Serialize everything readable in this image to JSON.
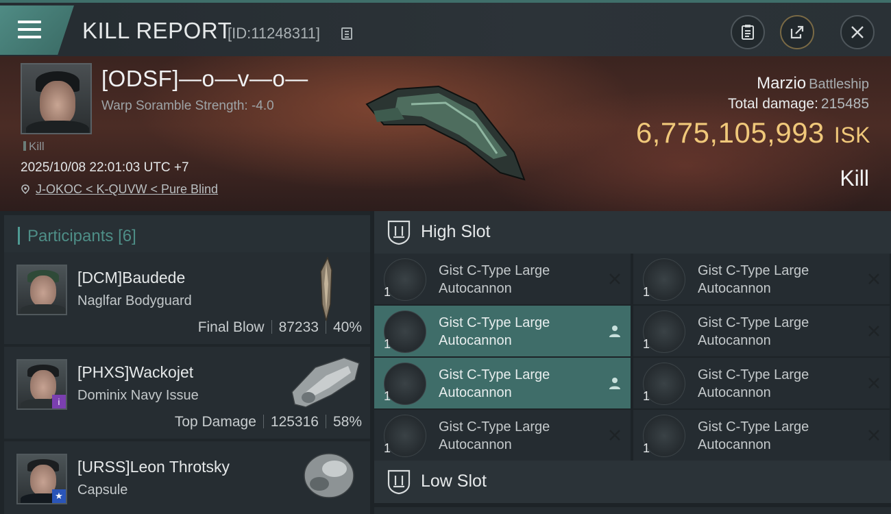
{
  "header": {
    "title": "KILL REPORT",
    "report_id": "[ID:11248311]"
  },
  "victim": {
    "name": "[ODSF]—o—v—o—",
    "subtitle": "Warp Soramble Strength: -4.0",
    "tag": "Kill",
    "timestamp": "2025/10/08 22:01:03 UTC +7",
    "location": "J-OKOC < K-QUVW < Pure Blind",
    "ship_name": "Marzio",
    "ship_class": "Battleship",
    "total_damage_label": "Total damage:",
    "total_damage": "215485",
    "isk_value": "6,775,105,993",
    "isk_unit": "ISK",
    "result": "Kill"
  },
  "participants": {
    "label": "Participants",
    "count": "[6]",
    "items": [
      {
        "name": "[DCM]Baudede",
        "ship": "Naglfar Bodyguard",
        "role": "Final Blow",
        "damage": "87233",
        "percent": "40%"
      },
      {
        "name": "[PHXS]Wackojet",
        "ship": "Dominix Navy Issue",
        "role": "Top Damage",
        "damage": "125316",
        "percent": "58%"
      },
      {
        "name": "[URSS]Leon Throtsky",
        "ship": "Capsule"
      }
    ]
  },
  "slots": {
    "high_label": "High Slot",
    "low_label": "Low Slot",
    "modules": [
      {
        "qty": "1",
        "name_line1": "Gist C-Type Large",
        "name_line2": "Autocannon",
        "status": "destroyed"
      },
      {
        "qty": "1",
        "name_line1": "Gist C-Type Large",
        "name_line2": "Autocannon",
        "status": "destroyed"
      },
      {
        "qty": "1",
        "name_line1": "Gist C-Type Large",
        "name_line2": "Autocannon",
        "status": "dropped"
      },
      {
        "qty": "1",
        "name_line1": "Gist C-Type Large",
        "name_line2": "Autocannon",
        "status": "destroyed"
      },
      {
        "qty": "1",
        "name_line1": "Gist C-Type Large",
        "name_line2": "Autocannon",
        "status": "dropped"
      },
      {
        "qty": "1",
        "name_line1": "Gist C-Type Large",
        "name_line2": "Autocannon",
        "status": "destroyed"
      },
      {
        "qty": "1",
        "name_line1": "Gist C-Type Large",
        "name_line2": "Autocannon",
        "status": "destroyed"
      },
      {
        "qty": "1",
        "name_line1": "Gist C-Type Large",
        "name_line2": "Autocannon",
        "status": "destroyed"
      }
    ]
  },
  "colors": {
    "accent": "#4f8b84",
    "isk": "#f0c87a",
    "highlight_row": "#3f6d69"
  }
}
